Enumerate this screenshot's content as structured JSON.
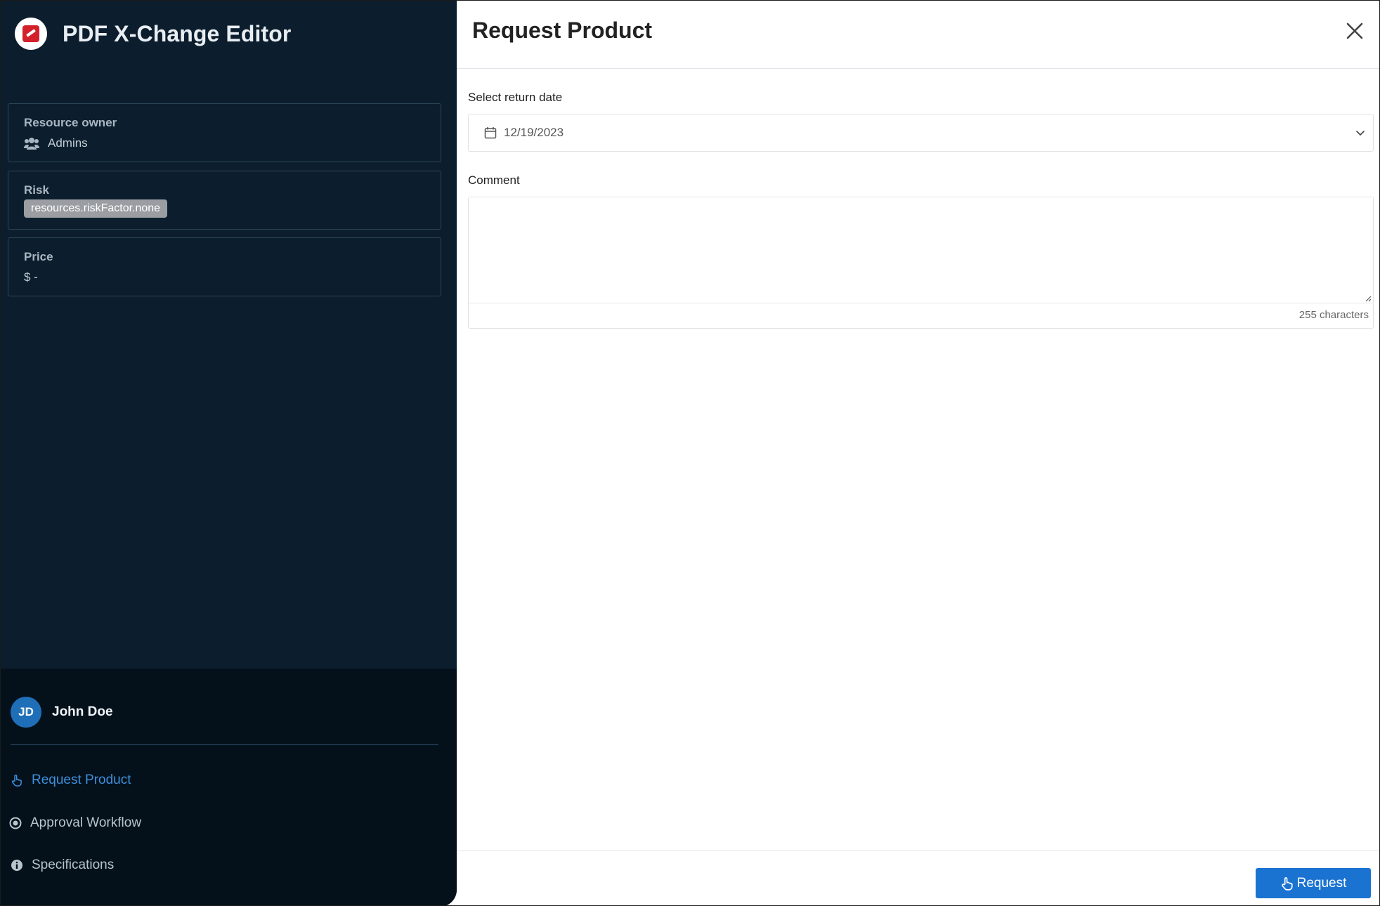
{
  "app": {
    "title": "PDF X-Change Editor"
  },
  "details": {
    "owner": {
      "label": "Resource owner",
      "value": "Admins",
      "icon": "users-icon"
    },
    "risk": {
      "label": "Risk",
      "badge": "resources.riskFactor.none"
    },
    "price": {
      "label": "Price",
      "value": "$ -"
    }
  },
  "user": {
    "initials": "JD",
    "name": "John Doe"
  },
  "nav": {
    "items": [
      {
        "label": "Request Product",
        "icon": "hand-pointer-icon",
        "active": true
      },
      {
        "label": "Approval Workflow",
        "icon": "target-circle-icon",
        "active": false
      },
      {
        "label": "Specifications",
        "icon": "info-circle-icon",
        "active": false
      }
    ]
  },
  "dialog": {
    "title": "Request Product",
    "return_date": {
      "label": "Select return date",
      "value": "12/19/2023"
    },
    "comment": {
      "label": "Comment",
      "value": "",
      "counter": "255 characters"
    },
    "submit_label": "Request"
  },
  "colors": {
    "sidebar_bg": "#0c1e2d",
    "sidebar_bottom_bg": "#04111b",
    "accent": "#1a73d1",
    "active_nav": "#3f8fdc",
    "avatar_bg": "#1f6fb8"
  }
}
